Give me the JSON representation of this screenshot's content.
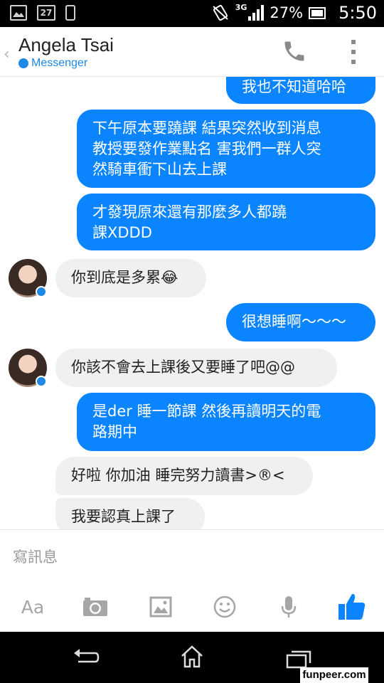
{
  "status_bar": {
    "calendar_day": "27",
    "network": "3G",
    "battery": "27%",
    "time": "5:50"
  },
  "header": {
    "contact_name": "Angela Tsai",
    "app_label": "Messenger"
  },
  "messages": [
    {
      "dir": "out",
      "text": "我也不知道哈哈"
    },
    {
      "dir": "out",
      "lines": [
        "下午原本要蹺課 結果突然收到消息",
        "教授要發作業點名 害我們一群人突",
        "然騎車衝下山去上課"
      ]
    },
    {
      "dir": "out",
      "lines": [
        "才發現原來還有那麼多人都蹺",
        "課XDDD"
      ]
    },
    {
      "dir": "in",
      "text": "你到底是多累😂"
    },
    {
      "dir": "out",
      "text": "很想睡啊～～～"
    },
    {
      "dir": "in",
      "text": "你該不會去上課後又要睡了吧@@"
    },
    {
      "dir": "out",
      "lines": [
        "是der 睡一節課 然後再讀明天的電",
        "路期中"
      ]
    },
    {
      "dir": "in",
      "text": "好啦 你加油 睡完努力讀書>®<"
    },
    {
      "dir": "in",
      "text": "我要認真上課了"
    }
  ],
  "composer": {
    "placeholder": "寫訊息",
    "text_tool_label": "Aa"
  },
  "watermark": "funpeer.com",
  "colors": {
    "accent": "#0a84ff",
    "messenger_blue": "#1e88e5",
    "incoming_bubble": "#f0f0f0"
  }
}
